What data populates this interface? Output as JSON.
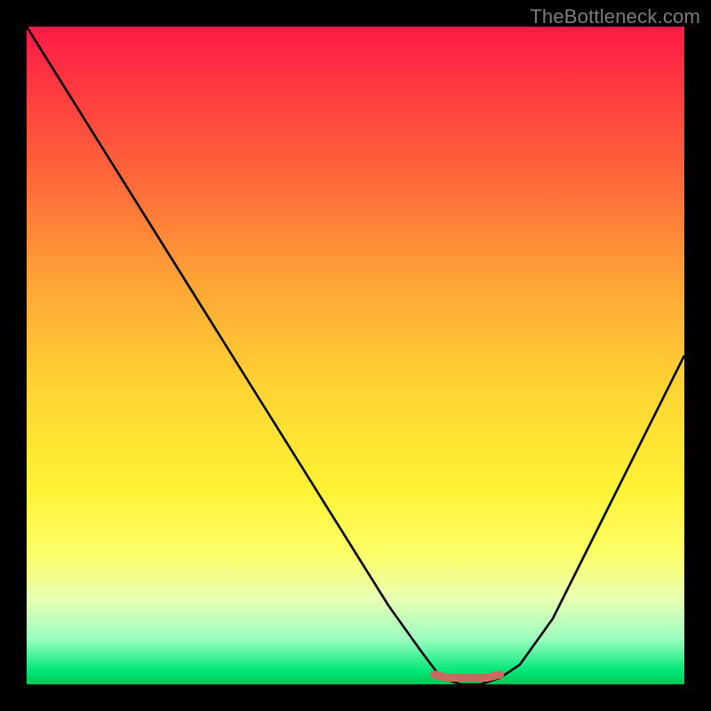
{
  "watermark": "TheBottleneck.com",
  "chart_data": {
    "type": "line",
    "title": "",
    "xlabel": "",
    "ylabel": "",
    "ylim": [
      0,
      100
    ],
    "xlim": [
      0,
      100
    ],
    "series": [
      {
        "name": "curve",
        "x": [
          0,
          5,
          10,
          15,
          20,
          25,
          30,
          35,
          40,
          45,
          50,
          55,
          60,
          63,
          66,
          69,
          72,
          75,
          80,
          85,
          90,
          95,
          100
        ],
        "values": [
          100,
          92,
          84,
          76,
          68,
          60,
          52,
          44,
          36,
          28,
          20,
          12,
          5,
          1,
          0,
          0,
          1,
          3,
          10,
          20,
          30,
          40,
          50
        ]
      },
      {
        "name": "marker-segment",
        "x": [
          62,
          64,
          66,
          68,
          70,
          72
        ],
        "values": [
          1.5,
          1.0,
          1.0,
          1.0,
          1.0,
          1.5
        ]
      }
    ],
    "colors": {
      "curve": "#000000",
      "marker": "#c86a5e"
    }
  }
}
